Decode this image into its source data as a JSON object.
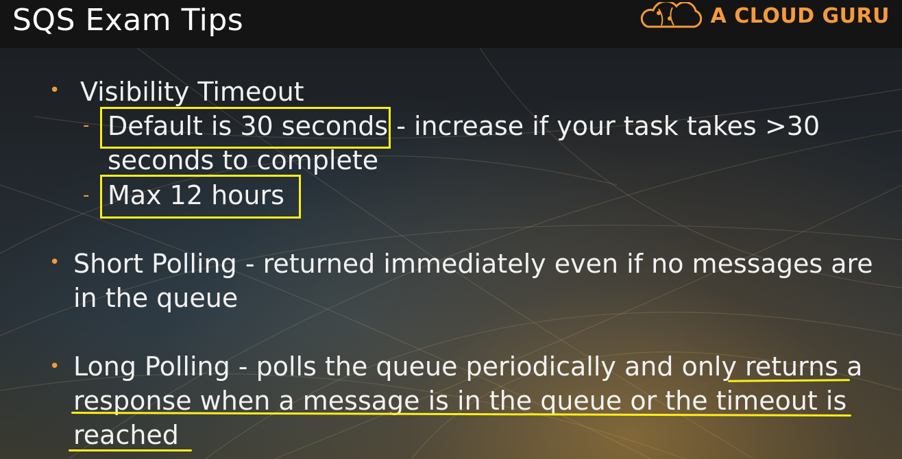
{
  "slide": {
    "title": "SQS Exam Tips",
    "brand": "A CLOUD GURU",
    "bullets": {
      "visibility": {
        "heading": "Visibility Timeout",
        "sub1_highlight": "Default is 30 seconds",
        "sub1_rest": " - increase if your task takes >30",
        "sub1_line2": "seconds to complete",
        "sub2": "Max 12 hours"
      },
      "short": {
        "line1": "Short Polling - returned immediately even if no messages are",
        "line2": "in the queue"
      },
      "long": {
        "line1_a": "Long Polling - polls the queue periodically and only ",
        "line1_b": "returns a",
        "line2": "response when a message is in the queue or the timeout is",
        "line3": "reached"
      }
    }
  },
  "colors": {
    "bullet": "#f59a3a",
    "highlight": "#ffef1a",
    "brand": "#f59a3a"
  }
}
